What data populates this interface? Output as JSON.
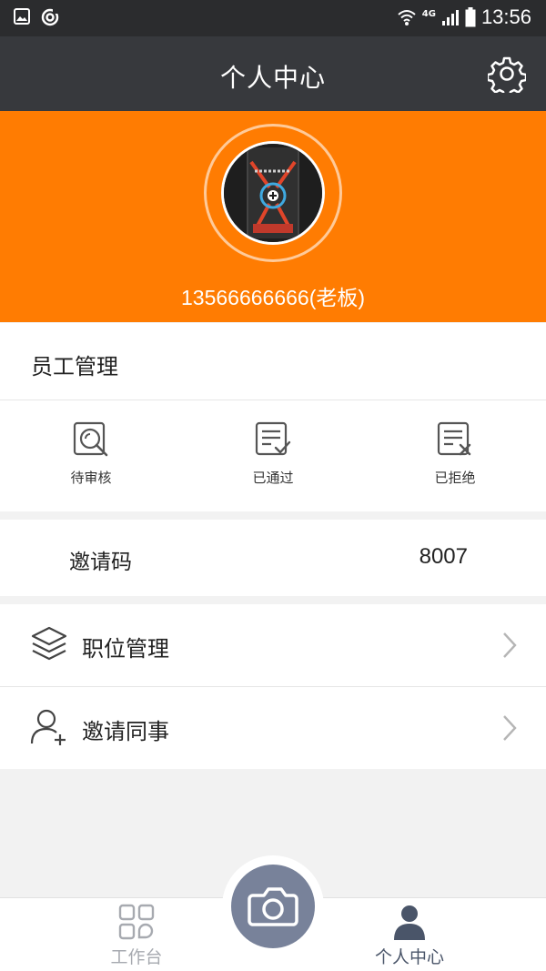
{
  "status_bar": {
    "network": "4G",
    "time": "13:56"
  },
  "header": {
    "title": "个人中心"
  },
  "profile": {
    "name": "13566666666(老板)"
  },
  "employee_management": {
    "title": "员工管理",
    "items": [
      {
        "label": "待审核",
        "icon": "pending-review-icon"
      },
      {
        "label": "已通过",
        "icon": "approved-icon"
      },
      {
        "label": "已拒绝",
        "icon": "rejected-icon"
      }
    ]
  },
  "invite_code": {
    "label": "邀请码",
    "value": "8007"
  },
  "menu": [
    {
      "label": "职位管理",
      "icon": "layers-icon"
    },
    {
      "label": "邀请同事",
      "icon": "add-user-icon"
    }
  ],
  "bottom_nav": {
    "tabs": [
      {
        "label": "工作台",
        "icon": "grid-icon",
        "active": false
      },
      {
        "label": "个人中心",
        "icon": "person-icon",
        "active": true
      }
    ],
    "center_button": "camera-icon"
  },
  "colors": {
    "accent": "#ff7c02",
    "header_bg": "#37393d",
    "status_bg": "#2b2c2e",
    "camera_button": "#78829a"
  }
}
